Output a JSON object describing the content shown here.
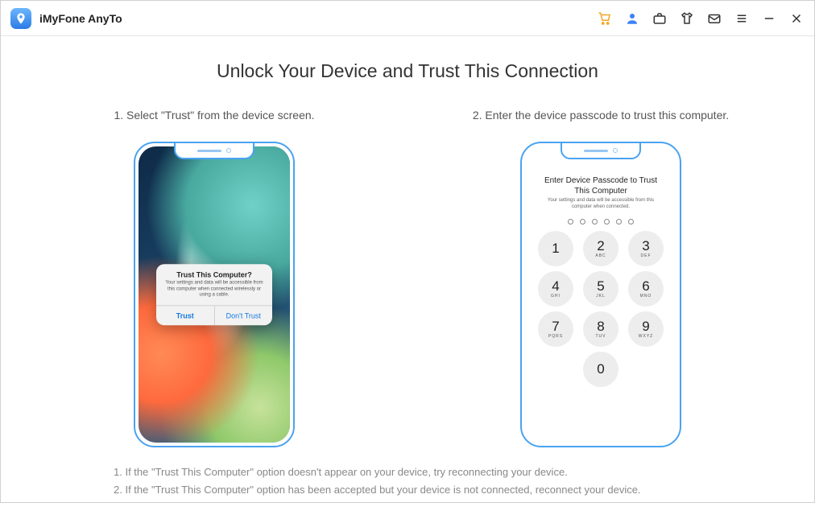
{
  "app": {
    "title": "iMyFone AnyTo"
  },
  "page": {
    "heading": "Unlock Your Device and Trust This Connection",
    "step1_label": "1. Select \"Trust\" from the device screen.",
    "step2_label": "2. Enter the device passcode to trust this computer."
  },
  "dialog": {
    "title": "Trust This Computer?",
    "message": "Your settings and data will be accessible from this computer when connected wirelessly or using a cable.",
    "trust": "Trust",
    "dont_trust": "Don't Trust"
  },
  "passcode": {
    "title": "Enter Device Passcode to Trust This Computer",
    "message": "Your settings and data will be accessible from this computer when connected.",
    "keys": [
      {
        "n": "1",
        "l": ""
      },
      {
        "n": "2",
        "l": "ABC"
      },
      {
        "n": "3",
        "l": "DEF"
      },
      {
        "n": "4",
        "l": "GHI"
      },
      {
        "n": "5",
        "l": "JKL"
      },
      {
        "n": "6",
        "l": "MNO"
      },
      {
        "n": "7",
        "l": "PQRS"
      },
      {
        "n": "8",
        "l": "TUV"
      },
      {
        "n": "9",
        "l": "WXYZ"
      }
    ],
    "zero": "0"
  },
  "notes": {
    "line1": "1. If the \"Trust This Computer\" option doesn't appear on your device, try reconnecting your device.",
    "line2": "2. If the \"Trust This Computer\" option has been accepted but your device is not connected, reconnect your device."
  }
}
